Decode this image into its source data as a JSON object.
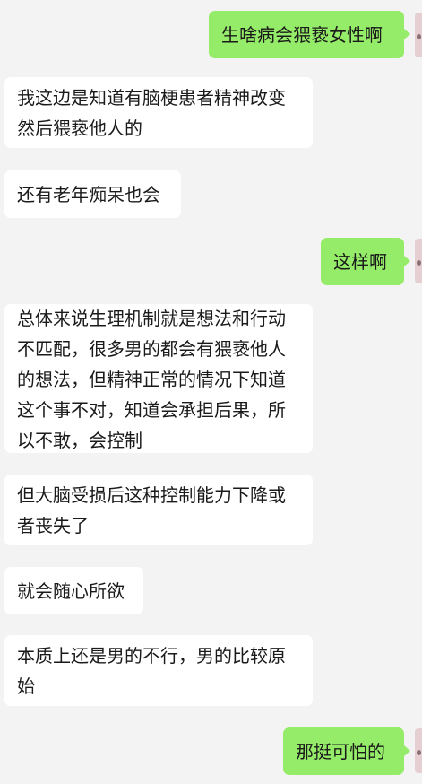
{
  "chat": {
    "messages": [
      {
        "side": "out",
        "text": "生啥病会猥亵女性啊"
      },
      {
        "side": "in",
        "text": "我这边是知道有脑梗患者精神改变然后猥亵他人的"
      },
      {
        "side": "in",
        "text": "还有老年痴呆也会"
      },
      {
        "side": "out",
        "text": "这样啊"
      },
      {
        "side": "in",
        "text": "总体来说生理机制就是想法和行动不匹配，很多男的都会有猥亵他人的想法，但精神正常的情况下知道这个事不对，知道会承担后果，所以不敢，会控制"
      },
      {
        "side": "in",
        "text": "但大脑受损后这种控制能力下降或者丧失了"
      },
      {
        "side": "in",
        "text": "就会随心所欲"
      },
      {
        "side": "in",
        "text": "本质上还是男的不行，男的比较原始"
      },
      {
        "side": "out",
        "text": "那挺可怕的"
      }
    ]
  },
  "colors": {
    "background": "#f3f3f3",
    "incoming_bubble": "#ffffff",
    "outgoing_bubble": "#95ec69",
    "text": "#1a1a1a"
  }
}
